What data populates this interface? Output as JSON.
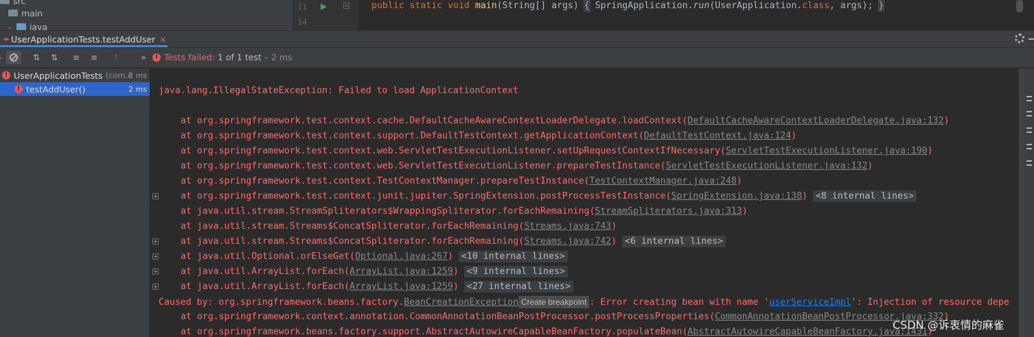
{
  "project_tree": {
    "items": [
      {
        "label": "src"
      },
      {
        "label": "main"
      },
      {
        "label": "java"
      }
    ]
  },
  "editor": {
    "line_numbers": [
      "11",
      "14"
    ],
    "code_tokens": {
      "public": "public",
      "static": "static",
      "void": "void",
      "main": "main",
      "params": "(String[] args) ",
      "brace_open": "{",
      "space1": " SpringApplication.",
      "run": "run",
      "args": "(UserApplication.",
      "class_kw": "class",
      "args_end": ", args); ",
      "brace_close": "}"
    }
  },
  "run_tab": {
    "label": "UserApplicationTests.testAddUser",
    "close": "×"
  },
  "toolbar": {
    "status_failed": "Tests failed:",
    "status_count": "1 of 1 test",
    "status_time": "– 2 ms"
  },
  "test_tree": {
    "root": {
      "name": "UserApplicationTests",
      "pkg": "(com.e",
      "time": "2 ms"
    },
    "child": {
      "name": "testAddUser()",
      "time": "2 ms"
    }
  },
  "console": {
    "exception": "java.lang.IllegalStateException: Failed to load ApplicationContext",
    "frames": [
      {
        "text": "at org.springframework.test.context.cache.DefaultCacheAwareContextLoaderDelegate.loadContext(",
        "link": "DefaultCacheAwareContextLoaderDelegate.java:132",
        "end": ")",
        "internal": ""
      },
      {
        "text": "at org.springframework.test.context.support.DefaultTestContext.getApplicationContext(",
        "link": "DefaultTestContext.java:124",
        "end": ")",
        "internal": ""
      },
      {
        "text": "at org.springframework.test.context.web.ServletTestExecutionListener.setUpRequestContextIfNecessary(",
        "link": "ServletTestExecutionListener.java:190",
        "end": ")",
        "internal": ""
      },
      {
        "text": "at org.springframework.test.context.web.ServletTestExecutionListener.prepareTestInstance(",
        "link": "ServletTestExecutionListener.java:132",
        "end": ")",
        "internal": ""
      },
      {
        "text": "at org.springframework.test.context.TestContextManager.prepareTestInstance(",
        "link": "TestContextManager.java:248",
        "end": ")",
        "internal": ""
      },
      {
        "text": "at org.springframework.test.context.junit.jupiter.SpringExtension.postProcessTestInstance(",
        "link": "SpringExtension.java:138",
        "end": ")",
        "internal": "<8 internal lines>"
      },
      {
        "text": "at java.util.stream.StreamSpliterators$WrappingSpliterator.forEachRemaining(",
        "link": "StreamSpliterators.java:313",
        "end": ")",
        "internal": ""
      },
      {
        "text": "at java.util.stream.Streams$ConcatSpliterator.forEachRemaining(",
        "link": "Streams.java:743",
        "end": ")",
        "internal": ""
      },
      {
        "text": "at java.util.stream.Streams$ConcatSpliterator.forEachRemaining(",
        "link": "Streams.java:742",
        "end": ")",
        "internal": "<6 internal lines>"
      },
      {
        "text": "at java.util.Optional.orElseGet(",
        "link": "Optional.java:267",
        "end": ")",
        "internal": "<10 internal lines>"
      },
      {
        "text": "at java.util.ArrayList.forEach(",
        "link": "ArrayList.java:1259",
        "end": ")",
        "internal": "<9 internal lines>"
      },
      {
        "text": "at java.util.ArrayList.forEach(",
        "link": "ArrayList.java:1259",
        "end": ")",
        "internal": "<27 internal lines>"
      }
    ],
    "caused_by": {
      "prefix": "Caused by: org.springframework.beans.factory.",
      "link": "BeanCreationException",
      "tooltip": "Create breakpoint",
      "middle": ": Error creating bean with name '",
      "bean": "userServiceImpl",
      "rest": "': Injection of resource depe"
    },
    "frames_after": [
      {
        "text": "at org.springframework.context.annotation.CommonAnnotationBeanPostProcessor.postProcessProperties(",
        "link": "CommonAnnotationBeanPostProcessor.java:332",
        "end": ")"
      },
      {
        "text": "at org.springframework.beans.factory.support.AbstractAutowireCapableBeanFactory.populateBean(",
        "link": "AbstractAutowireCapableBeanFactory.java:1431",
        "end": ")"
      }
    ]
  },
  "watermark": "CSDN @诉衷情的麻雀",
  "colors": {
    "error_red": "#ff6b68",
    "selection_blue": "#2f65ca",
    "tab_underline": "#4a88c7",
    "link_blue": "#287bde"
  }
}
